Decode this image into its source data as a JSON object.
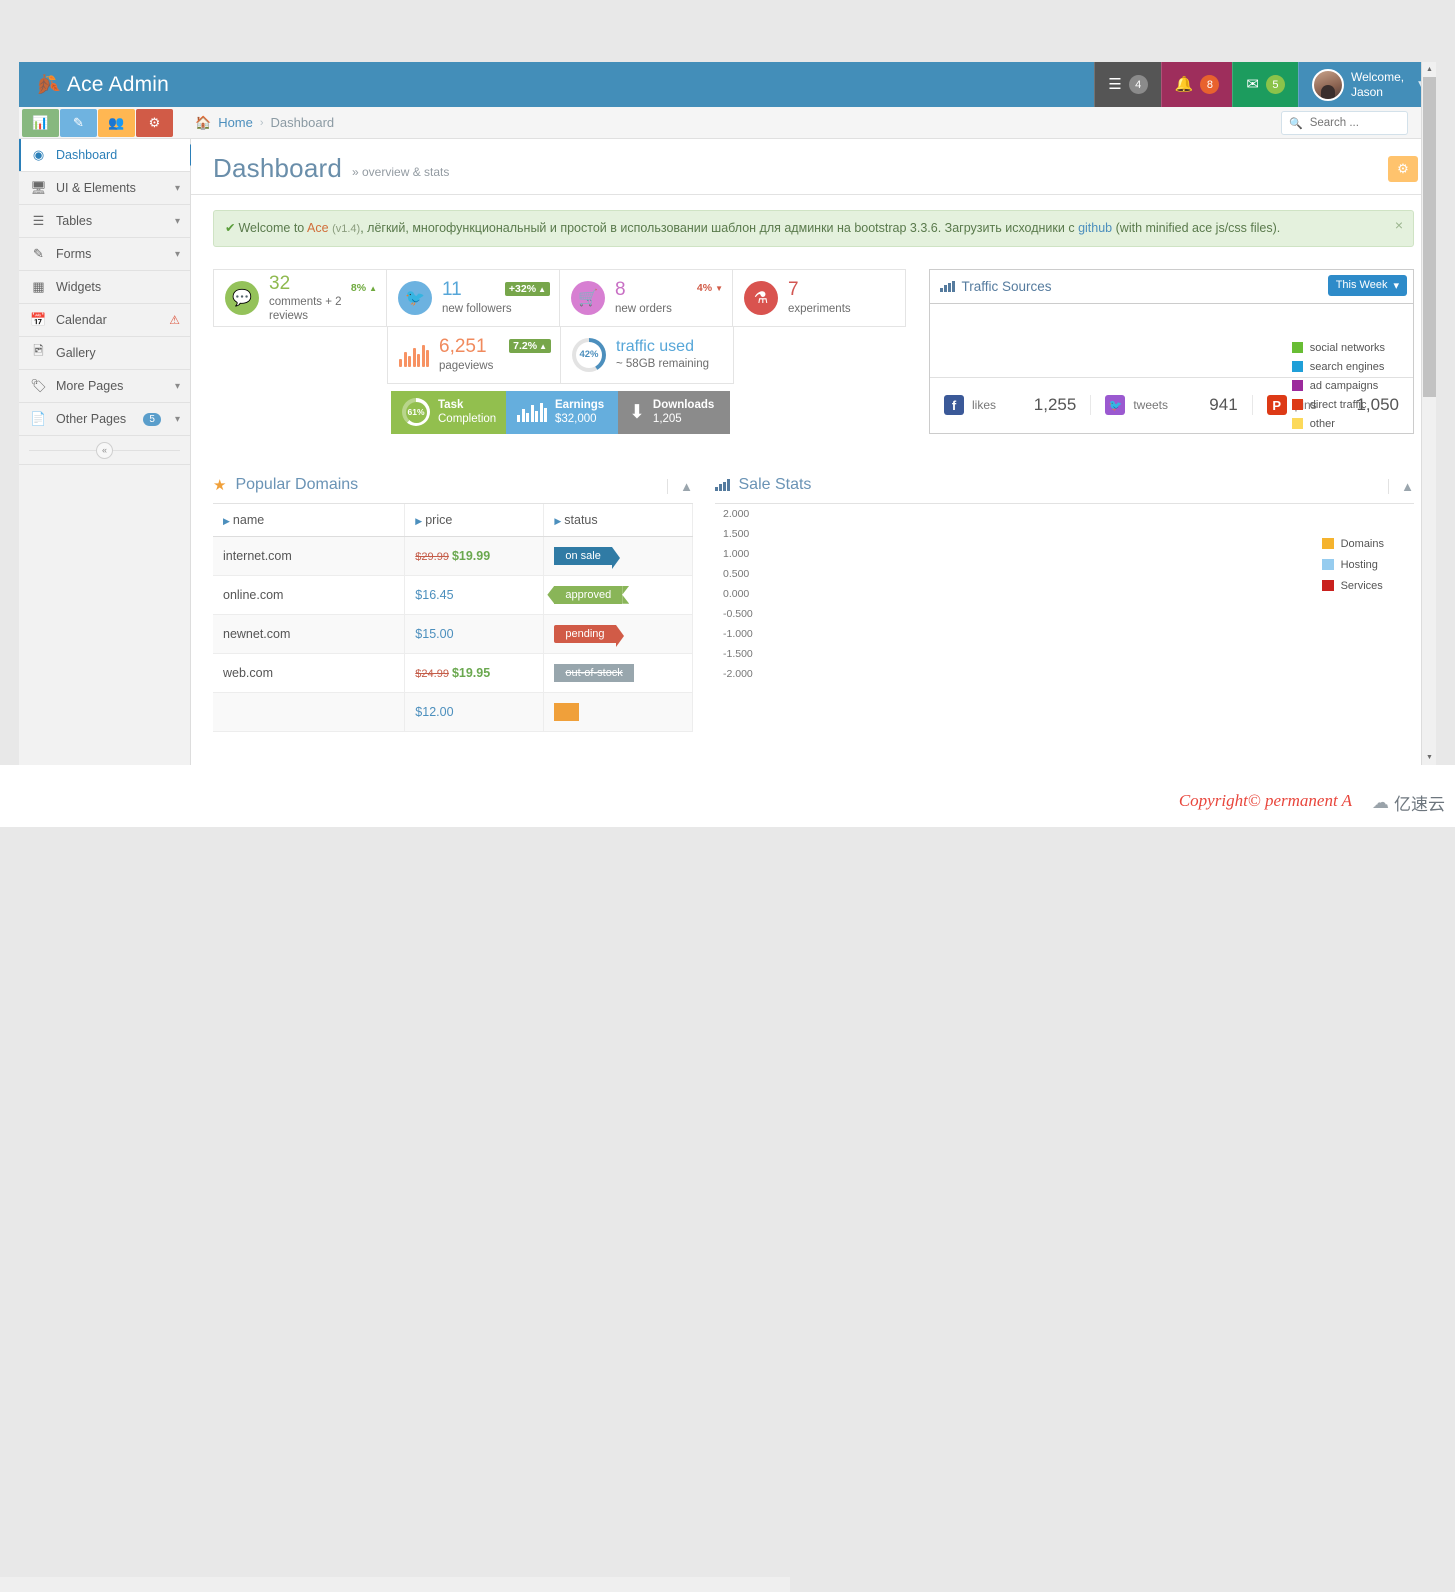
{
  "navbar": {
    "brand": "Ace Admin",
    "brand_icon": "leaf-icon",
    "items": [
      {
        "icon": "tasks-icon",
        "badge": "4",
        "name": "tasks"
      },
      {
        "icon": "bell-icon",
        "badge": "8",
        "name": "notifications"
      },
      {
        "icon": "envelope-icon",
        "badge": "5",
        "name": "messages"
      }
    ],
    "user": {
      "greeting": "Welcome,",
      "name": "Jason"
    }
  },
  "shortcuts": [
    {
      "name": "chart-shortcut",
      "icon": "bar-chart-icon",
      "color": "#87b87f"
    },
    {
      "name": "edit-shortcut",
      "icon": "pencil-icon",
      "color": "#6fb3e0"
    },
    {
      "name": "users-shortcut",
      "icon": "group-icon",
      "color": "#ffb752"
    },
    {
      "name": "settings-shortcut",
      "icon": "cogs-icon",
      "color": "#d15b47"
    }
  ],
  "breadcrumb": {
    "home": "Home",
    "separator": "›",
    "current": "Dashboard"
  },
  "search": {
    "placeholder": "Search ...",
    "value": ""
  },
  "sidebar": {
    "items": [
      {
        "label": "Dashboard",
        "icon": "dashboard-icon",
        "active": true
      },
      {
        "label": "UI & Elements",
        "icon": "desktop-icon",
        "chevron": true
      },
      {
        "label": "Tables",
        "icon": "list-icon",
        "chevron": true
      },
      {
        "label": "Forms",
        "icon": "edit-icon",
        "chevron": true
      },
      {
        "label": "Widgets",
        "icon": "widgets-icon"
      },
      {
        "label": "Calendar",
        "icon": "calendar-icon",
        "warning": true
      },
      {
        "label": "Gallery",
        "icon": "picture-icon"
      },
      {
        "label": "More Pages",
        "icon": "tag-icon",
        "chevron": true
      },
      {
        "label": "Other Pages",
        "icon": "file-icon",
        "badge": "5",
        "chevron": true
      }
    ],
    "collapse_icon": "chevron-double-left-icon"
  },
  "page": {
    "title": "Dashboard",
    "subtitle": "» overview & stats",
    "settings_icon": "gear-icon"
  },
  "alert": {
    "check": "✔",
    "prefix": "Welcome to",
    "ace": "Ace",
    "version": "(v1.4)",
    "text_ru": ", лёгкий, многофункциональный и простой в использовании шаблон для админки на bootstrap 3.3.6. Загрузить исходники с",
    "link": "github",
    "suffix": "(with minified ace js/css files).",
    "close": "×"
  },
  "infoboxes": [
    {
      "number": "32",
      "label": "comments + 2 reviews",
      "icon": "comments-icon",
      "color": "#94c25a",
      "stat": "8%",
      "stat_dir": "up",
      "stat_style": "plain"
    },
    {
      "number": "11",
      "label": "new followers",
      "icon": "twitter-icon",
      "color": "#6cb2e0",
      "stat": "+32%",
      "stat_dir": "up",
      "stat_style": "chip"
    },
    {
      "number": "8",
      "label": "new orders",
      "icon": "cart-icon",
      "color": "#d77fd2",
      "stat": "4%",
      "stat_dir": "down",
      "stat_style": "plain-red"
    },
    {
      "number": "7",
      "label": "experiments",
      "icon": "flask-icon",
      "color": "#d9534f",
      "stat": "",
      "stat_dir": "",
      "stat_style": "none"
    }
  ],
  "infoboxes2": [
    {
      "number": "6,251",
      "label": "pageviews",
      "icon": "bars-icon",
      "color": "#f79263",
      "stat": "7.2%",
      "stat_dir": "up",
      "stat_style": "chip"
    },
    {
      "number": "traffic used",
      "label": "~ 58GB remaining",
      "icon": "donut-icon",
      "percent": "42%",
      "color": "#4c8fbd"
    }
  ],
  "tiles": [
    {
      "title": "Task",
      "sub": "Completion",
      "percent": "61%",
      "color": "#92bf4e",
      "icon": "donut-icon"
    },
    {
      "title": "Earnings",
      "sub": "$32,000",
      "color": "#65aedd",
      "icon": "bars-icon"
    },
    {
      "title": "Downloads",
      "sub": "1,205",
      "color": "#8b8b8b",
      "icon": "download-icon"
    }
  ],
  "traffic": {
    "title": "Traffic Sources",
    "icon": "bar-chart-icon",
    "period": "This Week",
    "period_caret": "⌄",
    "legend": [
      {
        "label": "social networks",
        "color": "#68bd34"
      },
      {
        "label": "search engines",
        "color": "#1f9fd8"
      },
      {
        "label": "ad campaigns",
        "color": "#9c2a9c"
      },
      {
        "label": "direct traffic",
        "color": "#dd3a16"
      },
      {
        "label": "other",
        "color": "#fcd95a"
      }
    ],
    "social": [
      {
        "network": "likes",
        "icon": "facebook-icon",
        "color": "#3b5998",
        "value": "1,255"
      },
      {
        "network": "tweets",
        "icon": "twitter-icon",
        "color": "#9b59d0",
        "value": "941"
      },
      {
        "network": "pins",
        "icon": "pinterest-icon",
        "color": "#dd3a16",
        "value": "1,050"
      }
    ]
  },
  "domains": {
    "title": "Popular Domains",
    "icon": "star-icon",
    "collapse_icon": "chevron-up-icon",
    "columns": [
      "name",
      "price",
      "status"
    ],
    "rows": [
      {
        "name": "internet.com",
        "price_old": "$29.99",
        "price": "$19.99",
        "price_style": "sale",
        "status": "on sale",
        "status_style": "rb-blue"
      },
      {
        "name": "online.com",
        "price_old": "",
        "price": "$16.45",
        "price_style": "plain",
        "status": "approved",
        "status_style": "rb-green"
      },
      {
        "name": "newnet.com",
        "price_old": "",
        "price": "$15.00",
        "price_style": "plain",
        "status": "pending",
        "status_style": "rb-red"
      },
      {
        "name": "web.com",
        "price_old": "$24.99",
        "price": "$19.95",
        "price_style": "sale",
        "status": "out-of-stock",
        "status_style": "rb-grey"
      },
      {
        "name": "",
        "price_old": "",
        "price": "$12.00",
        "price_style": "plain",
        "status": "",
        "status_style": "rb-orange"
      }
    ]
  },
  "chart_data": {
    "type": "bar",
    "title": "Sale Stats",
    "icon": "bar-chart-icon",
    "collapse_icon": "chevron-up-icon",
    "categories": [],
    "series": [
      {
        "name": "Domains",
        "color": "#f5b32e",
        "values": []
      },
      {
        "name": "Hosting",
        "color": "#96ccef",
        "values": []
      },
      {
        "name": "Services",
        "color": "#c9211e",
        "values": []
      }
    ],
    "ylabel": "",
    "xlabel": "",
    "ylim": [
      -2.0,
      2.0
    ],
    "yticks": [
      "2.000",
      "1.500",
      "1.000",
      "0.500",
      "0.000",
      "-0.500",
      "-1.000",
      "-1.500",
      "-2.000"
    ],
    "grid": false,
    "legend_position": "right"
  },
  "footer": {
    "copyright": "Copyright© permanent A",
    "watermark": "亿速云"
  }
}
